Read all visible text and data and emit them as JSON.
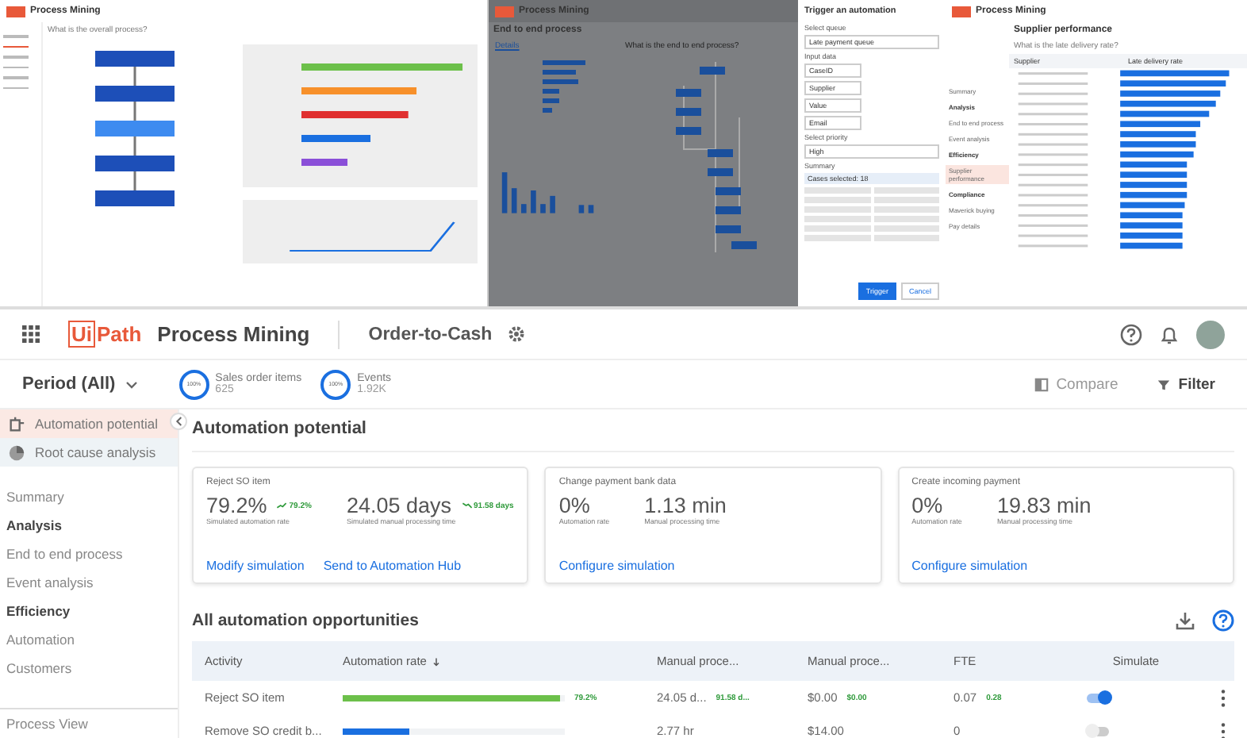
{
  "thumbnails": [
    {
      "kind": "process",
      "app_title": "Process Mining",
      "question": "What is the overall process?"
    },
    {
      "kind": "trigger",
      "app_title": "Process Mining",
      "page_title": "End to end process",
      "details_link": "Details",
      "chart_question": "What is the end to end process?",
      "dialog": {
        "title": "Trigger an automation",
        "fields": [
          {
            "label": "Select queue",
            "value": "Late payment queue"
          },
          {
            "label": "Select priority",
            "value": "High"
          }
        ],
        "input_label": "Input data",
        "inputs": [
          "CaseID",
          "Supplier",
          "Value",
          "Email"
        ],
        "summary_label": "Summary",
        "cases": "Cases selected: 18",
        "buttons": [
          {
            "label": "Trigger",
            "primary": true
          },
          {
            "label": "Cancel",
            "primary": false
          }
        ]
      }
    },
    {
      "kind": "suppliers",
      "app_title": "Process Mining",
      "page_title": "Supplier performance",
      "question": "What is the late delivery rate?",
      "columns": [
        "Supplier",
        "Late delivery rate"
      ],
      "nav": [
        {
          "label": "Summary",
          "heading": false,
          "selected": false
        },
        {
          "label": "Analysis",
          "heading": true,
          "selected": false
        },
        {
          "label": "End to end process",
          "heading": false,
          "selected": false
        },
        {
          "label": "Event analysis",
          "heading": false,
          "selected": false
        },
        {
          "label": "Efficiency",
          "heading": true,
          "selected": false
        },
        {
          "label": "Supplier performance",
          "heading": false,
          "selected": true
        },
        {
          "label": "Compliance",
          "heading": true,
          "selected": false
        },
        {
          "label": "Maverick buying",
          "heading": false,
          "selected": false
        },
        {
          "label": "Pay details",
          "heading": false,
          "selected": false
        }
      ]
    }
  ],
  "app": {
    "logo": {
      "boxed": "Ui",
      "rest": "Path"
    },
    "product": "Process Mining",
    "process": "Order-to-Cash",
    "period": "Period (All)",
    "stats": [
      {
        "percent": "100%",
        "label": "Sales order items",
        "value": "625"
      },
      {
        "percent": "100%",
        "label": "Events",
        "value": "1.92K"
      }
    ],
    "actions": [
      "Compare",
      "Filter"
    ],
    "sidebar": {
      "top_items": [
        {
          "label": "Automation potential",
          "selected": true
        },
        {
          "label": "Root cause analysis",
          "selected": false
        }
      ],
      "items": [
        {
          "label": "Summary",
          "heading": false
        },
        {
          "label": "Analysis",
          "heading": true
        },
        {
          "label": "End to end process",
          "heading": false
        },
        {
          "label": "Event analysis",
          "heading": false
        },
        {
          "label": "Efficiency",
          "heading": true
        },
        {
          "label": "Automation",
          "heading": false
        },
        {
          "label": "Customers",
          "heading": false
        }
      ],
      "footer": "Process View"
    },
    "page_title": "Automation potential",
    "cards": [
      {
        "title": "Reject SO item",
        "metrics": [
          {
            "value": "79.2%",
            "delta": "79.2%",
            "kind": "rise",
            "label": "Simulated automation rate"
          },
          {
            "value": "24.05 days",
            "delta": "91.58 days",
            "kind": "fall",
            "label": "Simulated manual processing time"
          }
        ],
        "links": [
          "Modify simulation",
          "Send to Automation Hub"
        ]
      },
      {
        "title": "Change payment bank data",
        "metrics": [
          {
            "value": "0%",
            "label": "Automation rate"
          },
          {
            "value": "1.13 min",
            "label": "Manual processing time"
          }
        ],
        "links": [
          "Configure simulation"
        ]
      },
      {
        "title": "Create incoming payment",
        "metrics": [
          {
            "value": "0%",
            "label": "Automation rate"
          },
          {
            "value": "19.83 min",
            "label": "Manual processing time"
          }
        ],
        "links": [
          "Configure simulation"
        ]
      }
    ],
    "table": {
      "title": "All automation opportunities",
      "columns": [
        {
          "label": "Activity",
          "sorted": false
        },
        {
          "label": "Automation rate",
          "sorted": true
        },
        {
          "label": "Manual proce...",
          "sorted": false
        },
        {
          "label": "Manual proce...",
          "sorted": false
        },
        {
          "label": "FTE",
          "sorted": false
        },
        {
          "label": "Simulate",
          "sorted": false
        }
      ],
      "rows": [
        {
          "activity": "Reject SO item",
          "level": 0.98,
          "color": "#6cc04a",
          "rate_delta": "79.2%",
          "time": "24.05 d...",
          "time_delta": "91.58 d...",
          "cost": "$0.00",
          "cost_delta": "$0.00",
          "fte": "0.07",
          "fte_delta": "0.28",
          "simulate": true
        },
        {
          "activity": "Remove SO credit b...",
          "level": 0.3,
          "color": "#1a6fe0",
          "time": "2.77 hr",
          "cost": "$14.00",
          "fte": "0",
          "simulate": false
        }
      ]
    }
  }
}
